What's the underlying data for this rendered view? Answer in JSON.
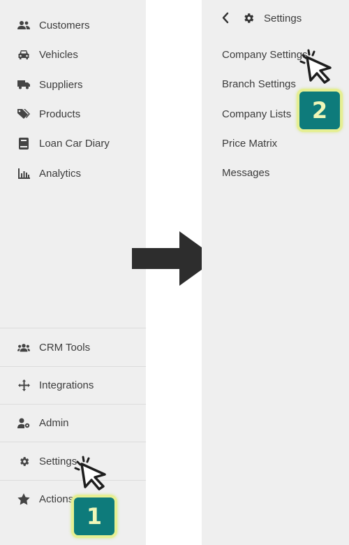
{
  "left_sidebar": {
    "items": [
      {
        "label": "Customers",
        "icon": "users-icon"
      },
      {
        "label": "Vehicles",
        "icon": "car-icon"
      },
      {
        "label": "Suppliers",
        "icon": "truck-icon"
      },
      {
        "label": "Products",
        "icon": "tags-icon"
      },
      {
        "label": "Loan Car Diary",
        "icon": "book-icon"
      },
      {
        "label": "Analytics",
        "icon": "bar-chart-icon"
      }
    ],
    "bottom_items": [
      {
        "label": "CRM Tools",
        "icon": "users-group-icon"
      },
      {
        "label": "Integrations",
        "icon": "move-arrows-icon"
      },
      {
        "label": "Admin",
        "icon": "user-cog-icon"
      },
      {
        "label": "Settings",
        "icon": "gear-icon"
      },
      {
        "label": "Actions",
        "icon": "star-icon"
      }
    ]
  },
  "settings_panel": {
    "header": {
      "title": "Settings",
      "back_icon": "chevron-left-icon",
      "icon": "gear-icon"
    },
    "items": [
      {
        "label": "Company Settings"
      },
      {
        "label": "Branch Settings"
      },
      {
        "label": "Company Lists"
      },
      {
        "label": "Price Matrix"
      },
      {
        "label": "Messages"
      }
    ]
  },
  "step_badges": {
    "first": "1",
    "second": "2"
  },
  "colors": {
    "badge_fill": "#0e7b7b",
    "badge_border": "#e6ef93",
    "panel_bg": "#efefef",
    "arrow": "#2d2d2d"
  }
}
